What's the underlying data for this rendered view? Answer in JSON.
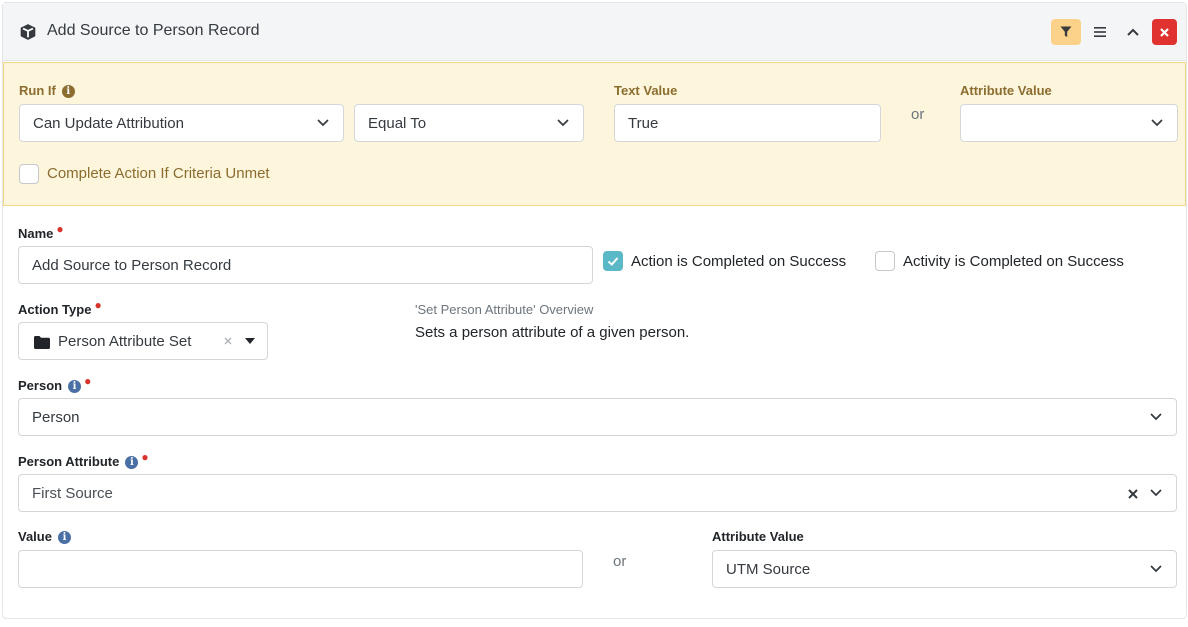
{
  "header": {
    "title": "Add Source to Person Record"
  },
  "criteria": {
    "run_if_label": "Run If",
    "run_if_value": "Can Update Attribution",
    "comparison_value": "Equal To",
    "text_value_label": "Text Value",
    "text_value": "True",
    "or": "or",
    "attribute_value_label": "Attribute Value",
    "attribute_value": "",
    "complete_if_unmet_label": "Complete Action If Criteria Unmet",
    "complete_if_unmet_checked": false
  },
  "form": {
    "name_label": "Name",
    "name_value": "Add Source to Person Record",
    "action_completed_label": "Action is Completed on Success",
    "action_completed_checked": true,
    "activity_completed_label": "Activity is Completed on Success",
    "activity_completed_checked": false,
    "action_type_label": "Action Type",
    "action_type_value": "Person Attribute Set",
    "overview_title": "'Set Person Attribute' Overview",
    "overview_text": "Sets a person attribute of a given person.",
    "person_label": "Person",
    "person_value": "Person",
    "person_attribute_label": "Person Attribute",
    "person_attribute_value": "First Source",
    "value_label": "Value",
    "value_value": "",
    "or": "or",
    "attribute_value_label": "Attribute Value",
    "attribute_value": "UTM Source"
  },
  "colors": {
    "criteria_bg": "#fef5dd",
    "filter_button": "#fcd28a",
    "close_button": "#e0322f",
    "checkbox_checked": "#5bb8c6",
    "required": "#d9342b"
  },
  "icons": {
    "header": "cube-icon",
    "filter": "filter-icon",
    "menu": "hamburger-icon",
    "collapse": "chevron-up-icon",
    "close": "close-icon",
    "folder": "folder-icon",
    "info": "info-icon",
    "dropdown": "chevron-down-icon",
    "clear": "clear-x-icon"
  }
}
